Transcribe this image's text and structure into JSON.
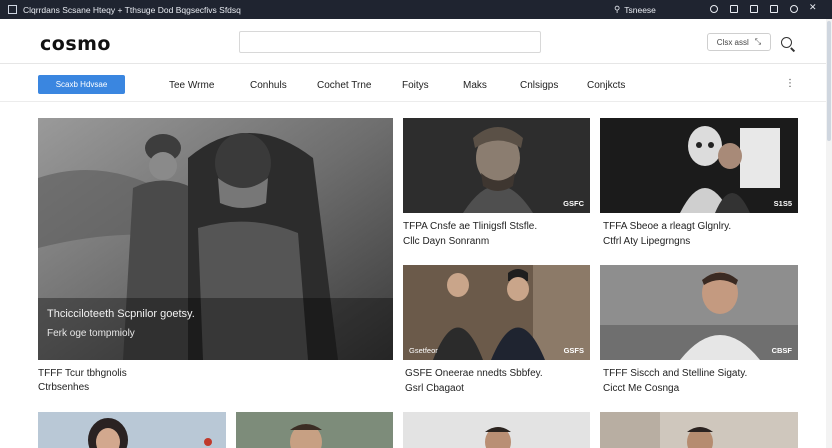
{
  "window": {
    "title": "Clqrrdans Scsane Hteqy + Tthsuge Dod Bqgsecfivs Sfdsq",
    "user": "Tsneese"
  },
  "header": {
    "logo": "cosmo",
    "search_placeholder": "",
    "action_label": "Clsx assl"
  },
  "nav": {
    "cta": "Scaxb Hdvsae",
    "items": [
      "Tee Wrme",
      "Conhuls",
      "Cochet Trne",
      "Foitys",
      "Maks",
      "Cnlsigps",
      "Conjkcts"
    ],
    "more": "⋮"
  },
  "hero": {
    "caption": "Thcicciloteeth Scpnilor goetsy.",
    "subcaption": "Ferk oge tompmioly",
    "title": "TFFF Tcur tbhgnolis",
    "subtitle": "Ctrbsenhes"
  },
  "cards": [
    {
      "title": "TFPA Cnsfe ae Tlinigsfl Stsfle.",
      "subtitle": "Cllc Dayn Sonranm",
      "badge": "GSFC"
    },
    {
      "title": "TFFA Sbeoe a rleagt Glgnlry.",
      "subtitle": "Ctfrl Aty Lipegrngns",
      "badge": "S1S5"
    },
    {
      "title": "GSFE Oneerae nnedts Sbbfey.",
      "subtitle": "Gsrl Cbagaot",
      "badge": "GSFS",
      "badge_left": "Gsetfeor"
    },
    {
      "title": "TFFF Siscch and Stelline Sigaty.",
      "subtitle": "Cicct Me Cosnga",
      "badge": "CBSF"
    }
  ],
  "colors": {
    "accent": "#3a86e0",
    "topbar": "#1f2430"
  }
}
